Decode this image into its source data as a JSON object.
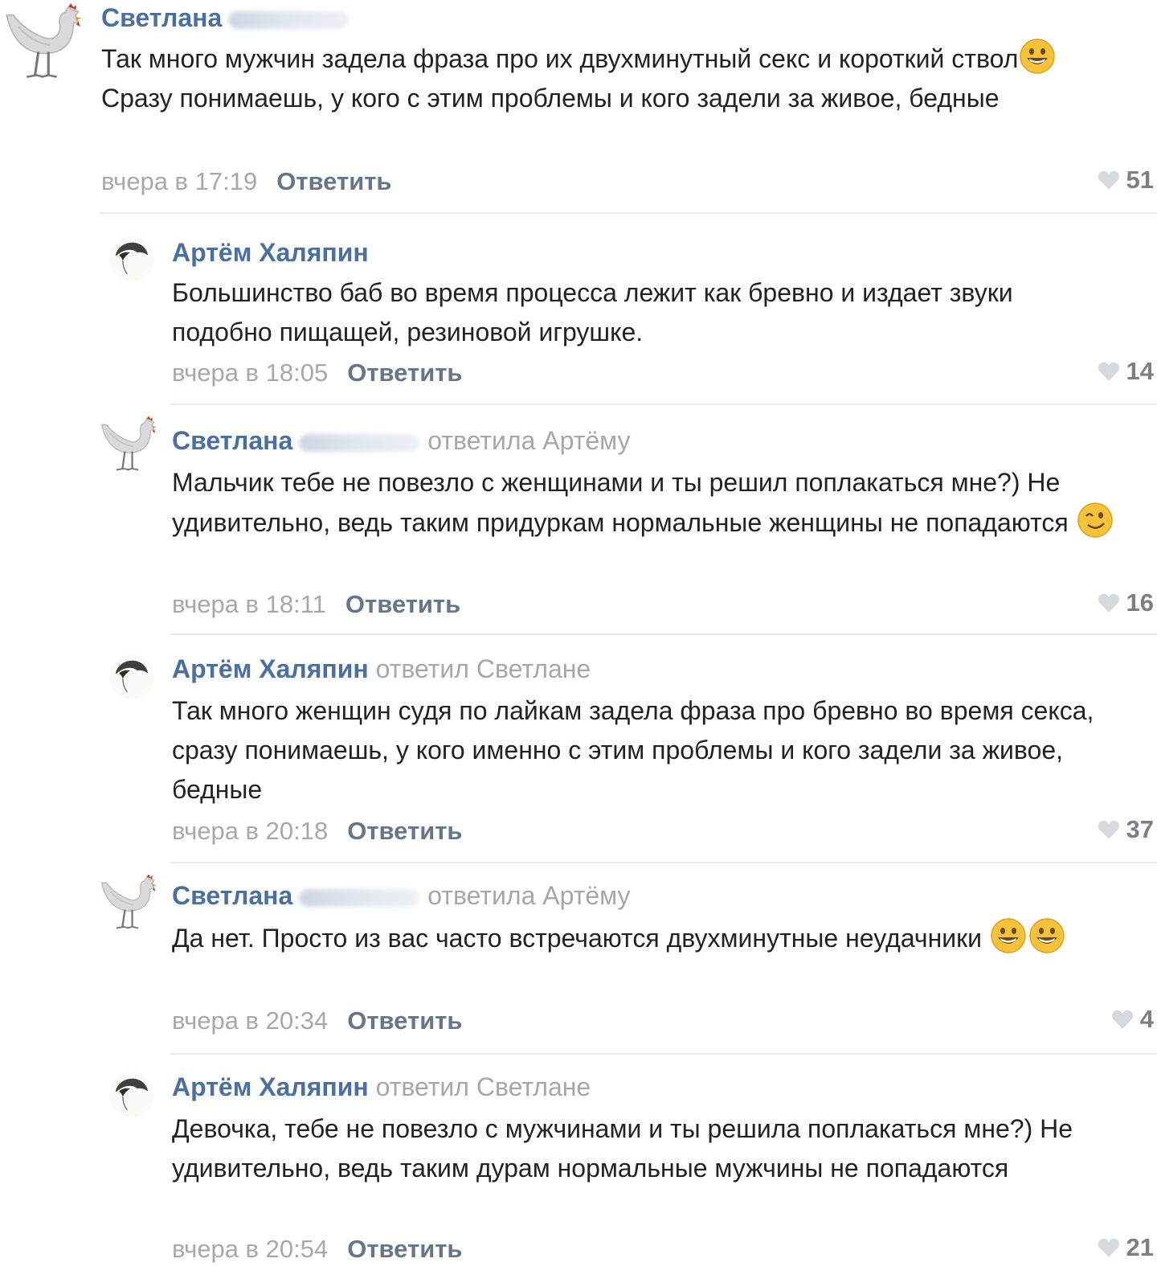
{
  "comments": [
    {
      "author": "Светлана",
      "reply_to": "",
      "text_parts": [
        "Так много мужчин задела фраза про их двухминутный секс и короткий ствол",
        " Сразу понимаешь, у кого с этим проблемы и кого задели за живое, бедные"
      ],
      "time": "вчера в 17:19",
      "reply_label": "Ответить",
      "likes": "51"
    },
    {
      "author": "Артём Халяпин",
      "reply_to": "",
      "text_parts": [
        "Большинство баб во время процесса лежит как бревно и издает звуки подобно пищащей, резиновой игрушке."
      ],
      "time": "вчера в 18:05",
      "reply_label": "Ответить",
      "likes": "14"
    },
    {
      "author": "Светлана",
      "reply_to": "ответила Артёму",
      "text_parts": [
        "Мальчик тебе не повезло с женщинами и ты решил поплакаться мне?) Не удивительно, ведь таким придуркам нормальные женщины не попадаются "
      ],
      "time": "вчера в 18:11",
      "reply_label": "Ответить",
      "likes": "16"
    },
    {
      "author": "Артём Халяпин",
      "reply_to": "ответил Светлане",
      "text_parts": [
        "Так много женщин судя по лайкам задела фраза про бревно во время секса, сразу понимаешь, у кого именно с этим проблемы и кого задели за живое, бедные"
      ],
      "time": "вчера в 20:18",
      "reply_label": "Ответить",
      "likes": "37"
    },
    {
      "author": "Светлана",
      "reply_to": "ответила Артёму",
      "text_parts": [
        "Да нет. Просто из вас часто встречаются двухминутные неудачники "
      ],
      "time": "вчера в 20:34",
      "reply_label": "Ответить",
      "likes": "4"
    },
    {
      "author": "Артём Халяпин",
      "reply_to": "ответил Светлане",
      "text_parts": [
        "Девочка, тебе не повезло с мужчинами и ты решила поплакаться мне?) Не удивительно, ведь таким дурам нормальные мужчины не попадаются"
      ],
      "time": "вчера в 20:54",
      "reply_label": "Ответить",
      "likes": "21"
    }
  ],
  "icons": {
    "chicken_avatar": "chicken-icon",
    "hair_avatar": "hair-avatar-icon",
    "grin_emoji": "grinning-face-emoji",
    "wink_emoji": "winking-face-emoji",
    "like": "heart-icon"
  },
  "colors": {
    "author": "#4a6fa0",
    "muted": "#a5a9ae",
    "reply_button": "#66768a",
    "separator": "#e7e8ec",
    "emoji": "#f6c23a"
  }
}
